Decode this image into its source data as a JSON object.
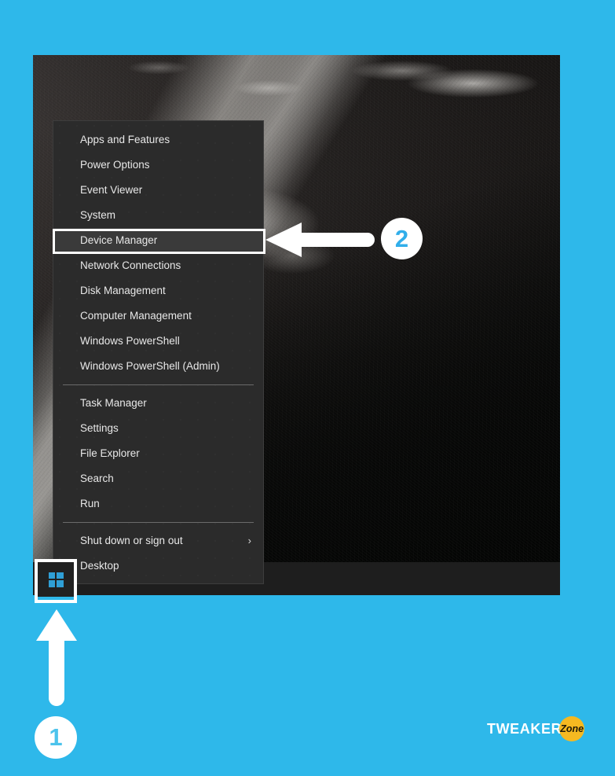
{
  "page": {
    "background_color": "#2eb8ea",
    "accent_blue": "#31aeea"
  },
  "desktop": {
    "wallpaper_description": "dark mountain slope with snow patches and forest",
    "taskbar": {
      "start_button": {
        "name": "Start",
        "icon": "windows-logo-icon",
        "highlighted": "true",
        "highlight_color": "#ffffff"
      }
    }
  },
  "winx_menu": {
    "groups": [
      {
        "items": [
          {
            "label": "Apps and Features",
            "selected": false,
            "submenu": false
          },
          {
            "label": "Power Options",
            "selected": false,
            "submenu": false
          },
          {
            "label": "Event Viewer",
            "selected": false,
            "submenu": false
          },
          {
            "label": "System",
            "selected": false,
            "submenu": false
          },
          {
            "label": "Device Manager",
            "selected": true,
            "submenu": false
          },
          {
            "label": "Network Connections",
            "selected": false,
            "submenu": false
          },
          {
            "label": "Disk Management",
            "selected": false,
            "submenu": false
          },
          {
            "label": "Computer Management",
            "selected": false,
            "submenu": false
          },
          {
            "label": "Windows PowerShell",
            "selected": false,
            "submenu": false
          },
          {
            "label": "Windows PowerShell (Admin)",
            "selected": false,
            "submenu": false
          }
        ]
      },
      {
        "items": [
          {
            "label": "Task Manager",
            "selected": false,
            "submenu": false
          },
          {
            "label": "Settings",
            "selected": false,
            "submenu": false
          },
          {
            "label": "File Explorer",
            "selected": false,
            "submenu": false
          },
          {
            "label": "Search",
            "selected": false,
            "submenu": false
          },
          {
            "label": "Run",
            "selected": false,
            "submenu": false
          }
        ]
      },
      {
        "items": [
          {
            "label": "Shut down or sign out",
            "selected": false,
            "submenu": true,
            "submenu_glyph": "›"
          },
          {
            "label": "Desktop",
            "selected": false,
            "submenu": false
          }
        ]
      }
    ]
  },
  "annotations": {
    "step_1": {
      "number": "1",
      "arrow": "up-arrow-icon",
      "points_to": "Start button"
    },
    "step_2": {
      "number": "2",
      "arrow": "left-arrow-icon",
      "points_to": "Device Manager"
    }
  },
  "watermark": {
    "brand": "TWEAKER",
    "badge": "Zone",
    "badge_color": "#f5b921"
  }
}
